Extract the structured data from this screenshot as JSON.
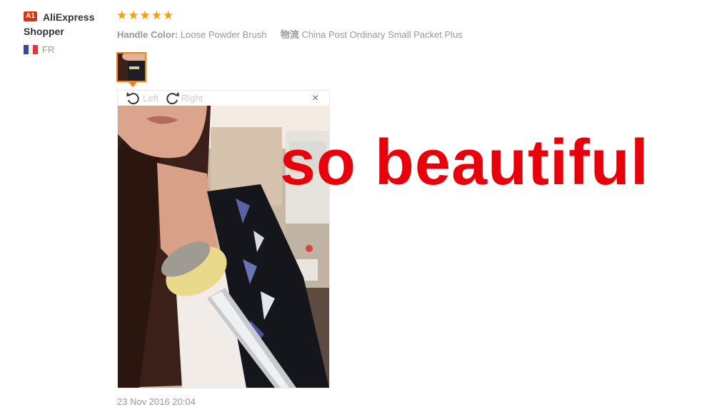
{
  "reviewer": {
    "level_badge": "A1",
    "name": "AliExpress Shopper",
    "country": "FR"
  },
  "review": {
    "rating_stars": 5,
    "attr1_label": "Handle Color:",
    "attr1_value": "Loose Powder Brush",
    "attr2_label": "物流",
    "attr2_value": "China Post Ordinary Small Packet Plus",
    "date": "23 Nov 2016 20:04"
  },
  "viewer": {
    "rotate_left_label": "Left",
    "rotate_right_label": "Right",
    "close_glyph": "×"
  },
  "overlay": {
    "text": "so beautiful",
    "color": "#e8000b"
  },
  "colors": {
    "star": "#ff9a00",
    "accent_border": "#ff7e00",
    "badge": "#e62e04",
    "muted_text": "#999999"
  },
  "icons": [
    "star-icon",
    "rotate-left-icon",
    "rotate-right-icon",
    "close-icon",
    "france-flag-icon"
  ]
}
